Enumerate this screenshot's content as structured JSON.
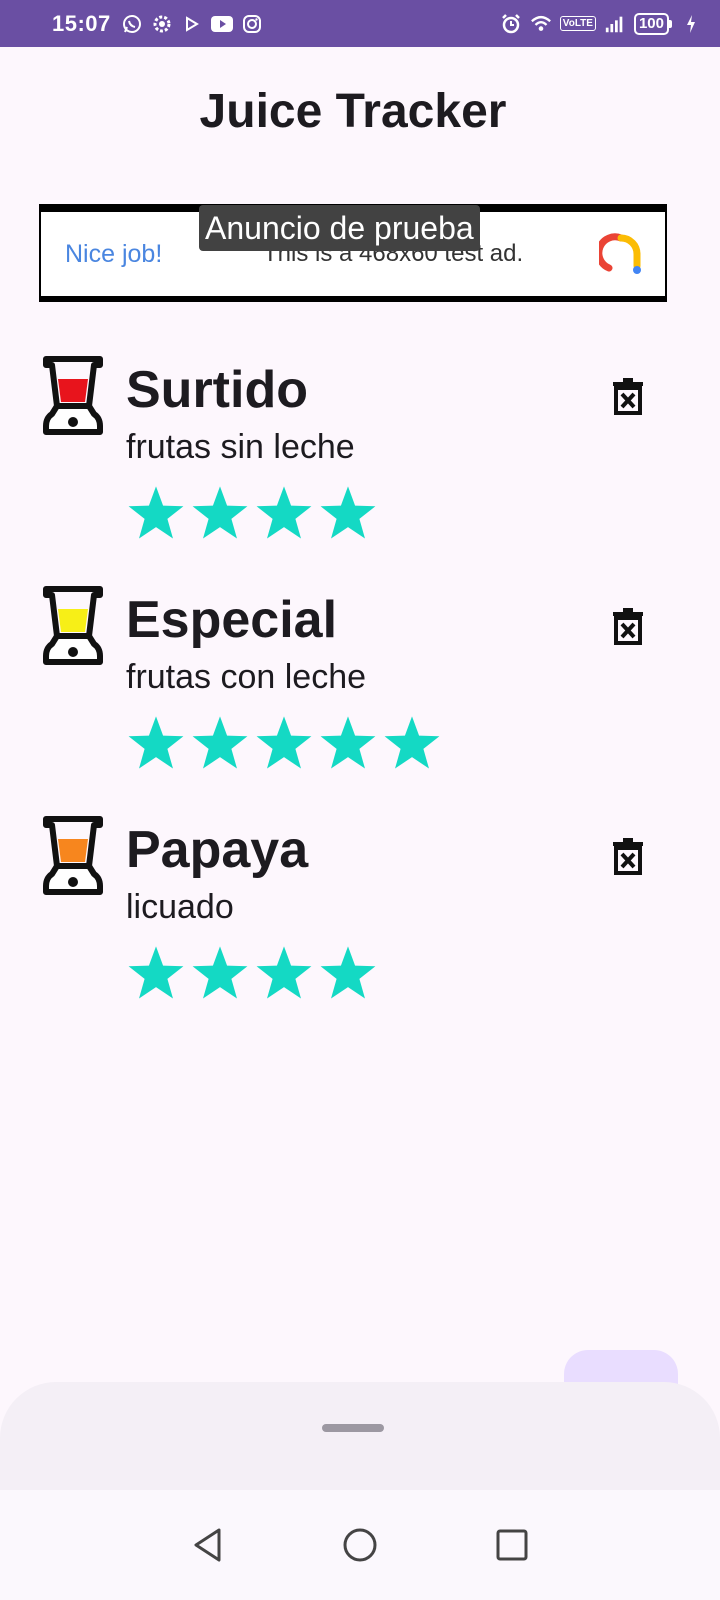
{
  "status_bar": {
    "time": "15:07",
    "left_icons": [
      "whatsapp-icon",
      "settings-icon",
      "play-store-icon",
      "youtube-icon",
      "instagram-icon"
    ],
    "volte": "VoLTE",
    "battery": "100"
  },
  "app": {
    "title": "Juice Tracker"
  },
  "ad": {
    "label": "Anuncio de prueba",
    "headline": "Nice job!",
    "body": "This is a 468x60 test ad."
  },
  "juices": [
    {
      "name": "Surtido",
      "description": "frutas sin leche",
      "rating": 4,
      "color": "#e8141c"
    },
    {
      "name": "Especial",
      "description": "frutas con leche",
      "rating": 5,
      "color": "#f7ef17"
    },
    {
      "name": "Papaya",
      "description": "licuado",
      "rating": 4,
      "color": "#f7861e"
    }
  ],
  "colors": {
    "star": "#14d9c4",
    "status_bar": "#6a4fa3",
    "fab": "#e9ddff"
  }
}
